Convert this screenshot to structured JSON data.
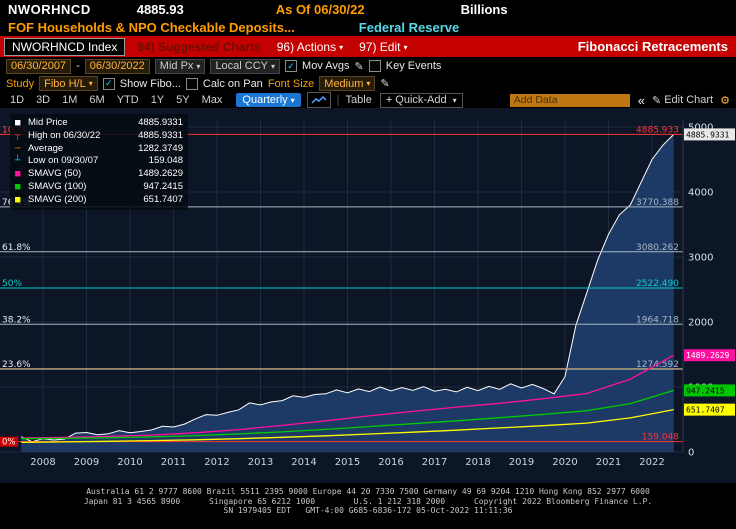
{
  "titlebar": {
    "ticker": "NWORHNCD",
    "value": "4885.93",
    "as_of": "As Of 06/30/22",
    "unit": "Billions",
    "description": "FOF Households & NPO Checkable Deposits...",
    "source": "Federal Reserve"
  },
  "menubar": {
    "security": "NWORHNCD Index",
    "suggested": "94) Suggested Charts",
    "actions": "96) Actions",
    "edit": "97) Edit",
    "function_title": "Fibonacci Retracements"
  },
  "toolbar": {
    "date_from": "06/30/2007",
    "date_to": "06/30/2022",
    "price_type": "Mid Px",
    "currency": "Local CCY",
    "mov_avgs_label": "Mov Avgs",
    "key_events_label": "Key Events"
  },
  "study_row": {
    "study_label": "Study",
    "study_value": "Fibo H/L",
    "show_fibo_label": "Show Fibo...",
    "calc_on_pan_label": "Calc on Pan",
    "font_size_label": "Font Size",
    "font_size_value": "Medium"
  },
  "period_row": {
    "tabs": [
      "1D",
      "3D",
      "1M",
      "6M",
      "YTD",
      "1Y",
      "5Y",
      "Max"
    ],
    "frequency": "Quarterly",
    "table_label": "Table",
    "quick_add_label": "Quick-Add",
    "add_data_placeholder": "Add Data",
    "edit_chart_label": "Edit Chart"
  },
  "legend": {
    "rows": [
      {
        "swatch": "■",
        "color": "#ffffff",
        "label": "Mid Price",
        "value": "4885.9331"
      },
      {
        "swatch": "┬",
        "color": "#ff3333",
        "label": "High on 06/30/22",
        "value": "4885.9331"
      },
      {
        "swatch": "─",
        "color": "#c87d0e",
        "label": "Average",
        "value": "1282.3749"
      },
      {
        "swatch": "┴",
        "color": "#00c8ff",
        "label": "Low on 09/30/07",
        "value": "159.048"
      },
      {
        "swatch": "■",
        "color": "#ff10a0",
        "label": "SMAVG (50)",
        "value": "1489.2629"
      },
      {
        "swatch": "■",
        "color": "#00cc00",
        "label": "SMAVG (100)",
        "value": "947.2415"
      },
      {
        "swatch": "■",
        "color": "#ffff00",
        "label": "SMAVG (200)",
        "value": "651.7407"
      }
    ]
  },
  "chart_data": {
    "type": "area",
    "title": "NWORHNCD Index - FOF Households & NPO Checkable Deposits",
    "ylabel": "Billions",
    "colors": {
      "chart_bg": "#0c1626",
      "grid": "#1e2c3e",
      "axis_text": "#d8dfe6",
      "fib_gray": "#a9b7c6",
      "fib_red": "#ff3333",
      "fib_cyan": "#00d0d0"
    },
    "x_axis": {
      "years": [
        2008,
        2009,
        2010,
        2011,
        2012,
        2013,
        2014,
        2015,
        2016,
        2017,
        2018,
        2019,
        2020,
        2021,
        2022
      ]
    },
    "y_axis": {
      "ticks": [
        0,
        1000,
        2000,
        3000,
        4000,
        5000
      ],
      "range": [
        0,
        5200
      ]
    },
    "average": {
      "label": "Average",
      "value": 1282.3749,
      "color": "#c87d0e"
    },
    "fibonacci": [
      {
        "pct": "100%",
        "pct_color": "#ff4444",
        "value": 4885.933,
        "label": "4885.933",
        "color": "#ff3333"
      },
      {
        "pct": "76.4%",
        "pct_color": "#e8eef4",
        "value": 3770.388,
        "label": "3770.388",
        "color": "#a9b7c6"
      },
      {
        "pct": "61.8%",
        "pct_color": "#e8eef4",
        "value": 3080.262,
        "label": "3080.262",
        "color": "#a9b7c6"
      },
      {
        "pct": "50%",
        "pct_color": "#00d0d0",
        "value": 2522.49,
        "label": "2522.490",
        "color": "#00d0d0"
      },
      {
        "pct": "38.2%",
        "pct_color": "#e8eef4",
        "value": 1964.718,
        "label": "1964.718",
        "color": "#a9b7c6"
      },
      {
        "pct": "23.6%",
        "pct_color": "#e8eef4",
        "value": 1274.592,
        "label": "1274.592",
        "color": "#a9b7c6"
      },
      {
        "pct": "0%",
        "pct_color": "#ffffff",
        "value": 159.048,
        "label": "159.048",
        "color": "#ff3333"
      }
    ],
    "series": [
      {
        "name": "Mid Price",
        "color": "#ffffff",
        "fill": "#1d3a66",
        "x": [
          2007.5,
          2007.75,
          2008.0,
          2008.25,
          2008.5,
          2008.75,
          2009.0,
          2009.25,
          2009.5,
          2009.75,
          2010.0,
          2010.25,
          2010.5,
          2010.75,
          2011.0,
          2011.25,
          2011.5,
          2011.75,
          2012.0,
          2012.25,
          2012.5,
          2012.75,
          2013.0,
          2013.25,
          2013.5,
          2013.75,
          2014.0,
          2014.25,
          2014.5,
          2014.75,
          2015.0,
          2015.25,
          2015.5,
          2015.75,
          2016.0,
          2016.25,
          2016.5,
          2016.75,
          2017.0,
          2017.25,
          2017.5,
          2017.75,
          2018.0,
          2018.25,
          2018.5,
          2018.75,
          2019.0,
          2019.25,
          2019.5,
          2019.75,
          2020.0,
          2020.25,
          2020.5,
          2020.75,
          2021.0,
          2021.25,
          2021.5,
          2021.75,
          2022.0,
          2022.25,
          2022.5
        ],
        "values": [
          235,
          159.048,
          205,
          185,
          200,
          290,
          300,
          265,
          280,
          330,
          295,
          315,
          340,
          395,
          385,
          430,
          510,
          575,
          565,
          610,
          650,
          755,
          725,
          770,
          790,
          865,
          840,
          885,
          895,
          955,
          910,
          970,
          930,
          1000,
          940,
          990,
          950,
          1005,
          935,
          965,
          925,
          995,
          945,
          1010,
          965,
          1050,
          985,
          1040,
          975,
          895,
          1160,
          1950,
          2450,
          2950,
          3350,
          3650,
          3800,
          4150,
          4500,
          4720,
          4885.9331
        ]
      },
      {
        "name": "SMAVG (50)",
        "color": "#ff10a0",
        "x": [
          2007.5,
          2008.5,
          2009.5,
          2010.5,
          2011.5,
          2012.5,
          2013.5,
          2014.5,
          2015.5,
          2016.5,
          2017.5,
          2018.5,
          2019.5,
          2020.5,
          2021.5,
          2022.5
        ],
        "values": [
          215,
          225,
          240,
          260,
          295,
          345,
          410,
          480,
          555,
          625,
          690,
          750,
          820,
          900,
          1120,
          1489.2629
        ]
      },
      {
        "name": "SMAVG (100)",
        "color": "#00cc00",
        "x": [
          2007.5,
          2008.5,
          2009.5,
          2010.5,
          2011.5,
          2012.5,
          2013.5,
          2014.5,
          2015.5,
          2016.5,
          2017.5,
          2018.5,
          2019.5,
          2020.5,
          2021.5,
          2022.5
        ],
        "values": [
          205,
          210,
          220,
          233,
          252,
          278,
          310,
          348,
          390,
          435,
          480,
          528,
          578,
          635,
          745,
          947.2415
        ]
      },
      {
        "name": "SMAVG (200)",
        "color": "#ffff00",
        "x": [
          2007.5,
          2008.5,
          2009.5,
          2010.5,
          2011.5,
          2012.5,
          2013.5,
          2014.5,
          2015.5,
          2016.5,
          2017.5,
          2018.5,
          2019.5,
          2020.5,
          2021.5,
          2022.5
        ],
        "values": [
          150,
          156,
          164,
          175,
          188,
          205,
          226,
          250,
          277,
          305,
          336,
          370,
          405,
          445,
          525,
          651.7407
        ]
      }
    ],
    "badges": [
      {
        "value": 4885.9331,
        "label": "4885.9331",
        "bg": "#e8e8e8",
        "fg": "#000000"
      },
      {
        "value": 1489.2629,
        "label": "1489.2629",
        "bg": "#ff10a0",
        "fg": "#ffffff"
      },
      {
        "value": 947.2415,
        "label": "947.2415",
        "bg": "#00c800",
        "fg": "#000000"
      },
      {
        "value": 651.7407,
        "label": "651.7407",
        "bg": "#ffff00",
        "fg": "#000000"
      }
    ]
  },
  "footer": {
    "line1": "Australia 61 2 9777 8600 Brazil 5511 2395 9000 Europe 44 20 7330 7500 Germany 49 69 9204 1210 Hong Kong 852 2977 6000",
    "line2": "Japan 81 3 4565 8900      Singapore 65 6212 1000        U.S. 1 212 318 2000      Copyright 2022 Bloomberg Finance L.P.",
    "line3": "SN 1979405 EDT   GMT-4:00 G685-6836-172 05-Oct-2022 11:11:36"
  }
}
